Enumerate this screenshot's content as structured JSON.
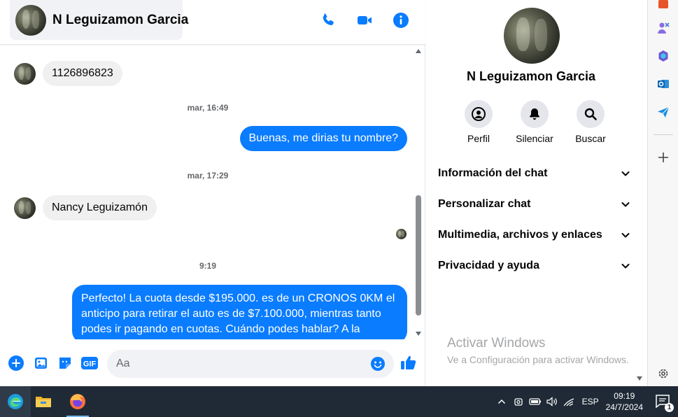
{
  "header": {
    "contact_name": "N Leguizamon Garcia",
    "call_icon": "phone-icon",
    "video_icon": "video-camera-icon",
    "info_icon": "info-icon"
  },
  "conversation": {
    "messages": [
      {
        "direction": "in",
        "text": "1126896823"
      },
      {
        "timestamp": "mar, 16:49"
      },
      {
        "direction": "out",
        "text": "Buenas, me dirias tu nombre?"
      },
      {
        "timestamp": "mar, 17:29"
      },
      {
        "direction": "in",
        "text": "Nancy Leguizamón"
      },
      {
        "timestamp": "9:19"
      },
      {
        "direction": "out",
        "text": "Perfecto! La cuota desde $195.000. es de un CRONOS 0KM el anticipo para retirar el auto es de $7.100.000, mientras tanto podes ir pagando en cuotas. Cuándo podes hablar? A la"
      }
    ]
  },
  "composer": {
    "placeholder": "Aa",
    "icons": [
      "add-icon",
      "image-icon",
      "sticker-icon",
      "gif-icon",
      "emoji-icon",
      "like-icon"
    ],
    "gif_label": "GIF"
  },
  "info_panel": {
    "name": "N Leguizamon Garcia",
    "actions": [
      {
        "label": "Perfil",
        "icon": "profile-icon"
      },
      {
        "label": "Silenciar",
        "icon": "bell-icon"
      },
      {
        "label": "Buscar",
        "icon": "search-icon"
      }
    ],
    "sections": [
      {
        "label": "Información del chat"
      },
      {
        "label": "Personalizar chat"
      },
      {
        "label": "Multimedia, archivos y enlaces"
      },
      {
        "label": "Privacidad y ayuda"
      }
    ]
  },
  "watermark": {
    "title": "Activar Windows",
    "subtitle": "Ve a Configuración para activar Windows."
  },
  "taskbar": {
    "apps": [
      "edge-icon",
      "file-explorer-icon",
      "firefox-icon"
    ],
    "language": "ESP",
    "time": "09:19",
    "date": "24/7/2024",
    "notification_count": "1"
  },
  "colors": {
    "accent": "#0a7cff",
    "incoming_bubble": "#f0f0f0",
    "taskbar": "#1f2a36"
  }
}
